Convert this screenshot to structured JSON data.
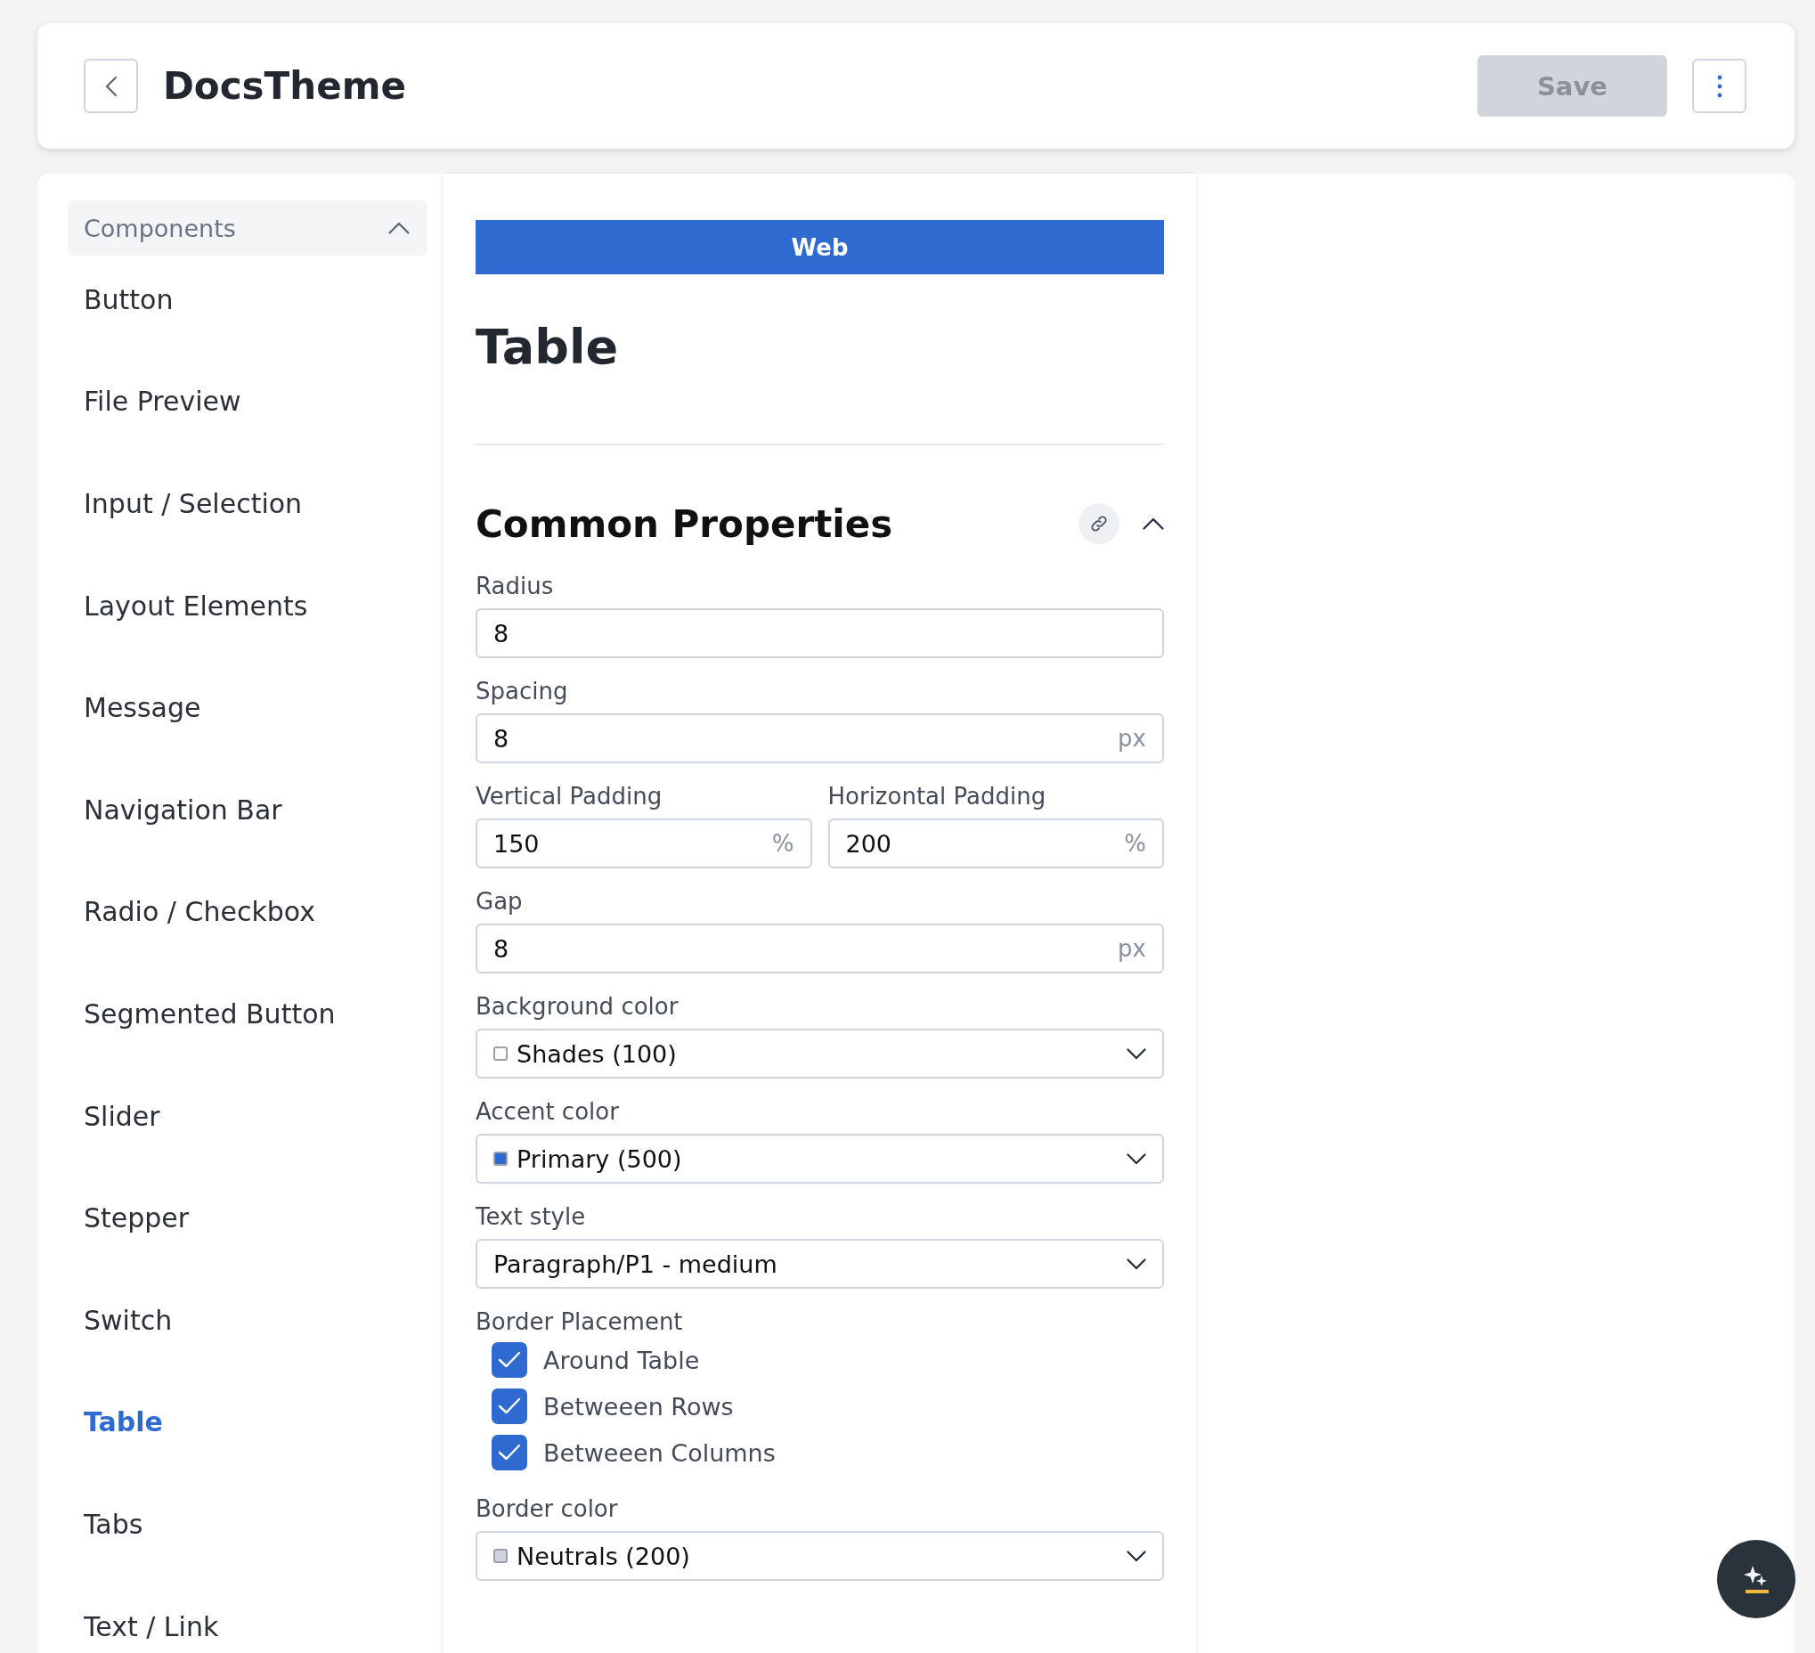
{
  "header": {
    "title": "DocsTheme",
    "save": {
      "label": "Save",
      "disabled": true
    }
  },
  "sidebar": {
    "section": {
      "label": "Components",
      "expanded": true
    },
    "items": [
      {
        "label": "Button",
        "selected": false
      },
      {
        "label": "File Preview",
        "selected": false
      },
      {
        "label": "Input / Selection",
        "selected": false
      },
      {
        "label": "Layout Elements",
        "selected": false
      },
      {
        "label": "Message",
        "selected": false
      },
      {
        "label": "Navigation Bar",
        "selected": false
      },
      {
        "label": "Radio / Checkbox",
        "selected": false
      },
      {
        "label": "Segmented Button",
        "selected": false
      },
      {
        "label": "Slider",
        "selected": false
      },
      {
        "label": "Stepper",
        "selected": false
      },
      {
        "label": "Switch",
        "selected": false
      },
      {
        "label": "Table",
        "selected": true
      },
      {
        "label": "Tabs",
        "selected": false
      },
      {
        "label": "Text / Link",
        "selected": false
      }
    ]
  },
  "editor": {
    "platform_tab": "Web",
    "title": "Table",
    "section": {
      "title": "Common Properties",
      "expanded": true
    },
    "fields": [
      {
        "kind": "input",
        "label": "Radius",
        "value": "8"
      },
      {
        "kind": "input",
        "label": "Spacing",
        "value": "8",
        "unit": "px"
      },
      {
        "kind": "pair",
        "items": [
          {
            "label": "Vertical Padding",
            "value": "150",
            "unit": "%"
          },
          {
            "label": "Horizontal Padding",
            "value": "200",
            "unit": "%"
          }
        ]
      },
      {
        "kind": "input",
        "label": "Gap",
        "value": "8",
        "unit": "px"
      },
      {
        "kind": "select",
        "label": "Background color",
        "value": "Shades (100)",
        "color": "#ffffff"
      },
      {
        "kind": "select",
        "label": "Accent color",
        "value": "Primary (500)",
        "color": "#2f6ad1"
      },
      {
        "kind": "select",
        "label": "Text style",
        "value": "Paragraph/P1 - medium"
      },
      {
        "kind": "checkboxes",
        "label": "Border Placement",
        "options": [
          {
            "label": "Around Table",
            "checked": true
          },
          {
            "label": "Betweeen Rows",
            "checked": true
          },
          {
            "label": "Betweeen Columns",
            "checked": true
          }
        ]
      },
      {
        "kind": "select",
        "label": "Border color",
        "value": "Neutrals (200)",
        "color": "#d0d5dd"
      }
    ]
  }
}
